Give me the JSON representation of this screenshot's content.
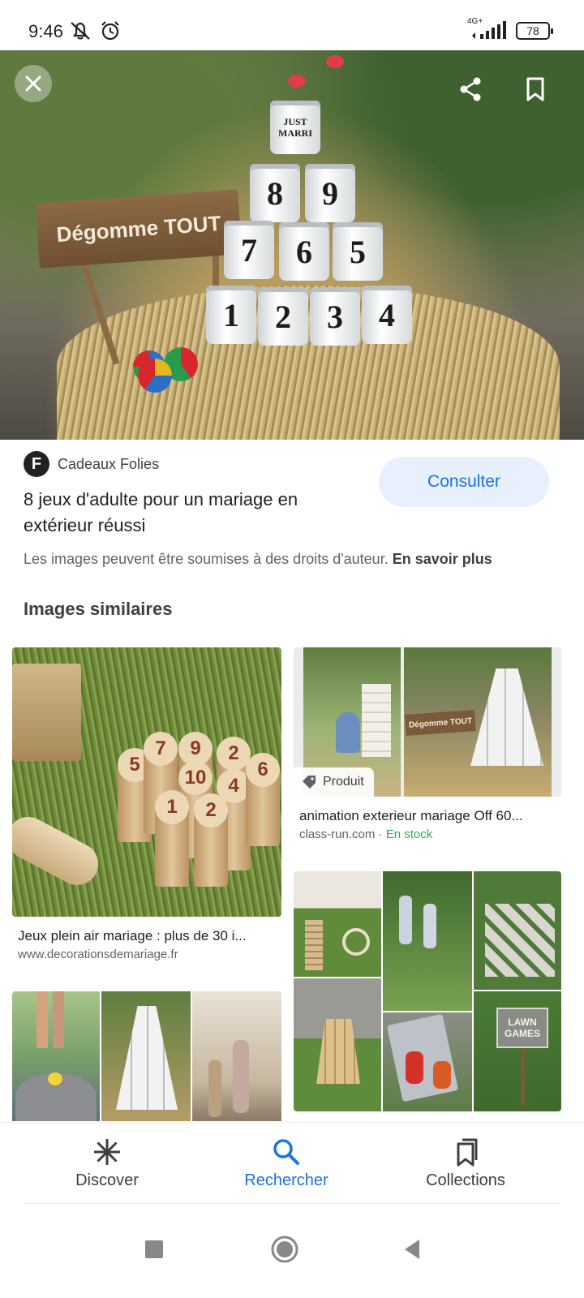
{
  "status_bar": {
    "time": "9:46",
    "network": "4G+",
    "battery": "78"
  },
  "hero": {
    "sign_text": "Dégomme TOUT",
    "top_can_text": "JUST MARRI",
    "cans": [
      "8",
      "9",
      "7",
      "6",
      "5",
      "1",
      "2",
      "3",
      "4"
    ]
  },
  "result": {
    "source_initial": "F",
    "source_name": "Cadeaux Folies",
    "title": "8 jeux d'adulte pour un mariage en extérieur réussi",
    "consult_label": "Consulter",
    "copyright_text": "Les images peuvent être soumises à des droits d'auteur.",
    "learn_more": "En savoir plus"
  },
  "similar": {
    "section_title": "Images similaires",
    "items": [
      {
        "title": "Jeux plein air mariage : plus de 30 i...",
        "url": "www.decorationsdemariage.fr",
        "pins": [
          "5",
          "7",
          "9",
          "2",
          "10",
          "4",
          "6",
          "1",
          "2"
        ]
      },
      {
        "badge": "Produit",
        "title": "animation exterieur mariage Off 60...",
        "url": "class-run.com",
        "stock": "En stock",
        "sign_text": "Dégomme TOUT"
      },
      {
        "sign_text": "LAWN GAMES"
      }
    ]
  },
  "bottom_nav": {
    "items": [
      {
        "label": "Discover",
        "icon": "asterisk-icon"
      },
      {
        "label": "Rechercher",
        "icon": "search-icon"
      },
      {
        "label": "Collections",
        "icon": "collections-icon"
      }
    ],
    "active": "Rechercher"
  },
  "colors": {
    "accent": "#1a73e8",
    "consult_bg": "#e8f0fe",
    "stock_green": "#34a853"
  }
}
